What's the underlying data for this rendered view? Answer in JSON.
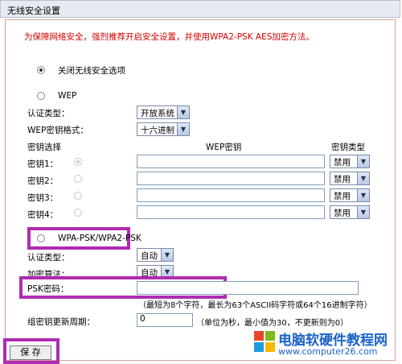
{
  "title": "无线安全设置",
  "notice": "为保障网络安全，强烈推荐开启安全设置，并使用WPA2-PSK AES加密方法。",
  "options": {
    "disable": "关闭无线安全选项",
    "wep": "WEP",
    "wpa": "WPA-PSK/WPA2-PSK"
  },
  "wep": {
    "auth_label": "认证类型：",
    "auth_value": "开放系统",
    "format_label": "WEP密钥格式：",
    "format_value": "十六进制",
    "key_select_header": "密钥选择",
    "key_header": "WEP密钥",
    "type_header": "密钥类型",
    "keys": [
      {
        "label": "密钥1：",
        "type": "禁用"
      },
      {
        "label": "密钥2：",
        "type": "禁用"
      },
      {
        "label": "密钥3：",
        "type": "禁用"
      },
      {
        "label": "密钥4：",
        "type": "禁用"
      }
    ]
  },
  "wpa": {
    "auth_label": "认证类型：",
    "auth_value": "自动",
    "algo_label": "加密算法：",
    "algo_value": "自动",
    "psk_label": "PSK密码：",
    "psk_hint": "（最短为8个字符，最长为63个ASCII码字符或64个16进制字符）",
    "group_label": "组密钥更新周期：",
    "group_value": "0",
    "group_hint": "（单位为秒，最小值为30，不更新则为0）"
  },
  "save_label": "保 存",
  "watermark": {
    "title": "电脑软硬件教程网",
    "url": "www.computer26.com"
  },
  "colors": {
    "notice": "#d40000",
    "highlight": "#b02cb0",
    "watermark": "#1a62c8"
  }
}
